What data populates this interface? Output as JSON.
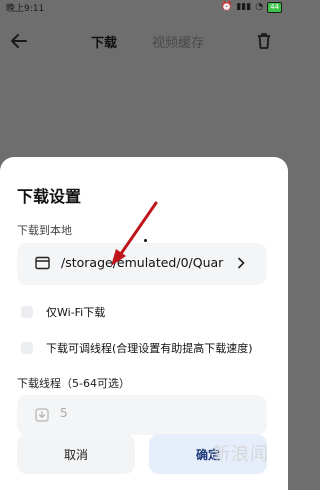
{
  "statusbar": {
    "time": "晚上9:11",
    "battery": "44"
  },
  "topbar": {
    "tab_download": "下载",
    "tab_cache": "视频缓存"
  },
  "sheet": {
    "title": "下载设置",
    "local_label": "下载到本地",
    "path": "/storage/emulated/0/Quar",
    "wifi_only": "仅Wi-Fi下载",
    "adjustable_threads": "下载可调线程(合理设置有助提高下载速度)",
    "threads_label": "下载线程（5-64可选）",
    "threads_value": "5",
    "cancel": "取消",
    "confirm": "确定"
  },
  "watermark": "新浪闻",
  "colors": {
    "arrow": "#c0151b",
    "overlay": "#6e6e6e",
    "confirm_text": "#1d3b7a"
  }
}
